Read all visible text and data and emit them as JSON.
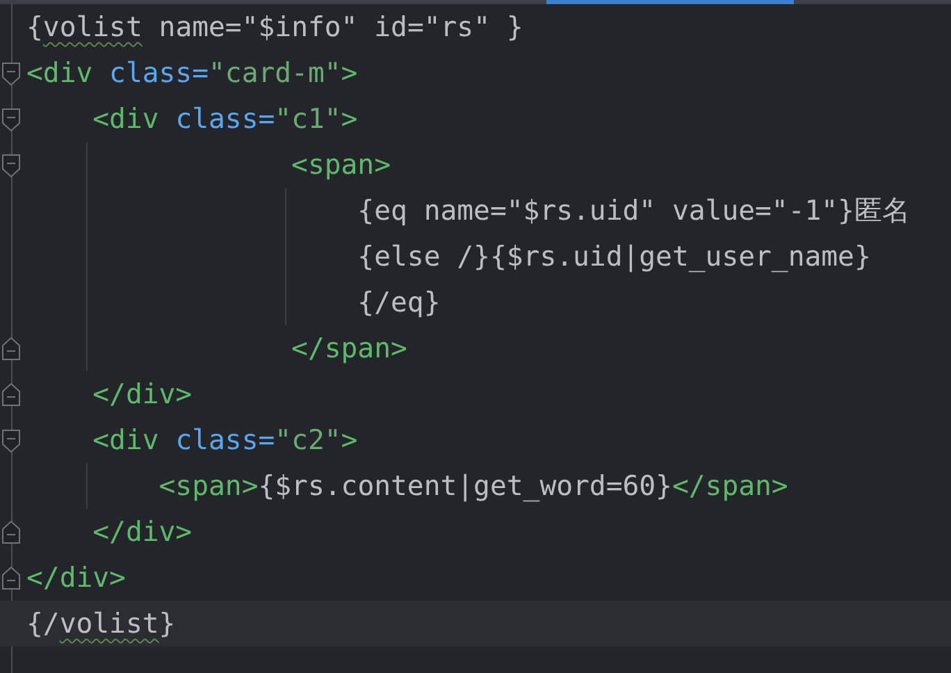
{
  "editor": {
    "lines": [
      {
        "fold_start": false,
        "fold_end": false,
        "current": false,
        "tokens": [
          {
            "kind": "plain",
            "text": "{"
          },
          {
            "kind": "warn",
            "text": "volist"
          },
          {
            "kind": "plain",
            "text": " name=\"$info\" id=\"rs\" }"
          }
        ]
      },
      {
        "fold_start": true,
        "fold_end": false,
        "current": false,
        "tokens": [
          {
            "kind": "tag",
            "text": "<div "
          },
          {
            "kind": "attr",
            "text": "class="
          },
          {
            "kind": "string",
            "text": "\"card-m\""
          },
          {
            "kind": "tag",
            "text": ">"
          }
        ]
      },
      {
        "fold_start": true,
        "fold_end": false,
        "current": false,
        "tokens": [
          {
            "kind": "tag",
            "text": "    <div "
          },
          {
            "kind": "attr",
            "text": "class="
          },
          {
            "kind": "string",
            "text": "\"c1\""
          },
          {
            "kind": "tag",
            "text": ">"
          }
        ]
      },
      {
        "fold_start": true,
        "fold_end": false,
        "current": false,
        "tokens": [
          {
            "kind": "tag",
            "text": "                <span>"
          }
        ]
      },
      {
        "fold_start": false,
        "fold_end": false,
        "current": false,
        "tokens": [
          {
            "kind": "plain",
            "text": "                    {eq name=\"$rs.uid\" value=\"-1\"}匿名"
          }
        ]
      },
      {
        "fold_start": false,
        "fold_end": false,
        "current": false,
        "tokens": [
          {
            "kind": "plain",
            "text": "                    {else /}{$rs.uid|get_user_name}"
          }
        ]
      },
      {
        "fold_start": false,
        "fold_end": false,
        "current": false,
        "tokens": [
          {
            "kind": "plain",
            "text": "                    {/eq}"
          }
        ]
      },
      {
        "fold_start": false,
        "fold_end": true,
        "current": false,
        "tokens": [
          {
            "kind": "tag",
            "text": "                </span>"
          }
        ]
      },
      {
        "fold_start": false,
        "fold_end": true,
        "current": false,
        "tokens": [
          {
            "kind": "tag",
            "text": "    </div>"
          }
        ]
      },
      {
        "fold_start": true,
        "fold_end": false,
        "current": false,
        "tokens": [
          {
            "kind": "tag",
            "text": "    <div "
          },
          {
            "kind": "attr",
            "text": "class="
          },
          {
            "kind": "string",
            "text": "\"c2\""
          },
          {
            "kind": "tag",
            "text": ">"
          }
        ]
      },
      {
        "fold_start": false,
        "fold_end": false,
        "current": false,
        "tokens": [
          {
            "kind": "tag",
            "text": "        <span>"
          },
          {
            "kind": "plain",
            "text": "{$rs.content|get_word=60}"
          },
          {
            "kind": "tag",
            "text": "</span>"
          }
        ]
      },
      {
        "fold_start": false,
        "fold_end": true,
        "current": false,
        "tokens": [
          {
            "kind": "tag",
            "text": "    </div>"
          }
        ]
      },
      {
        "fold_start": false,
        "fold_end": true,
        "current": false,
        "tokens": [
          {
            "kind": "tag",
            "text": "</div>"
          }
        ]
      },
      {
        "fold_start": false,
        "fold_end": false,
        "current": true,
        "tokens": [
          {
            "kind": "plain",
            "text": "{/"
          },
          {
            "kind": "warn",
            "text": "volist"
          },
          {
            "kind": "plain",
            "text": "}"
          }
        ]
      }
    ]
  }
}
